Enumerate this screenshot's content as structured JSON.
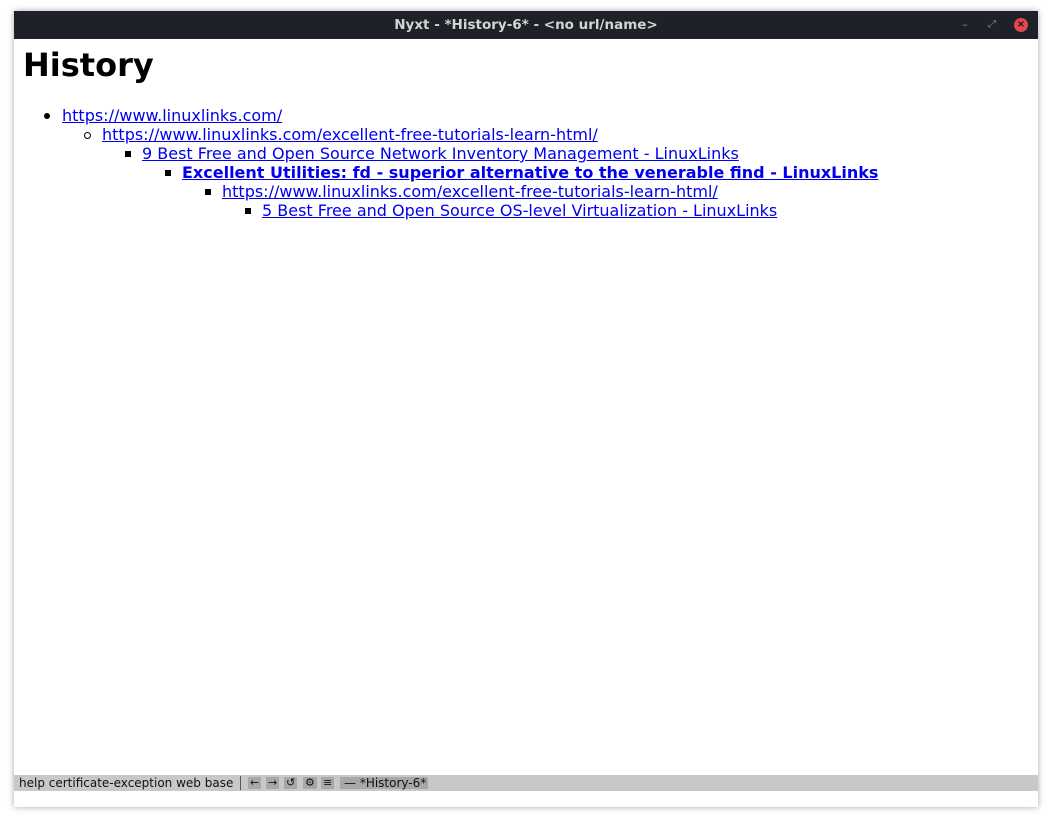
{
  "window": {
    "title": "Nyxt - *History-6* - <no url/name>",
    "minimize_glyph": "–",
    "maximize_glyph": "⤢",
    "close_glyph": "×"
  },
  "page": {
    "heading": "History",
    "tree": [
      {
        "level": 0,
        "bullet": "disc",
        "text": "https://www.linuxlinks.com/",
        "current": false
      },
      {
        "level": 1,
        "bullet": "circle",
        "text": "https://www.linuxlinks.com/excellent-free-tutorials-learn-html/",
        "current": false
      },
      {
        "level": 2,
        "bullet": "square",
        "text": "9 Best Free and Open Source Network Inventory Management - LinuxLinks",
        "current": false
      },
      {
        "level": 3,
        "bullet": "square",
        "text": "Excellent Utilities: fd - superior alternative to the venerable find - LinuxLinks",
        "current": true
      },
      {
        "level": 4,
        "bullet": "square",
        "text": "https://www.linuxlinks.com/excellent-free-tutorials-learn-html/",
        "current": false
      },
      {
        "level": 5,
        "bullet": "square",
        "text": "5 Best Free and Open Source OS-level Virtualization - LinuxLinks",
        "current": false
      }
    ]
  },
  "statusbar": {
    "modes": "help certificate-exception web base",
    "back": "←",
    "forward": "→",
    "reload": "↺",
    "execute": "⚙",
    "menu": "≡",
    "buffer": "— *History-6*"
  },
  "colors": {
    "titlebar": "#1e2127",
    "link": "#0000ee",
    "statusbar": "#c8c8c8",
    "close": "#e0474f"
  }
}
